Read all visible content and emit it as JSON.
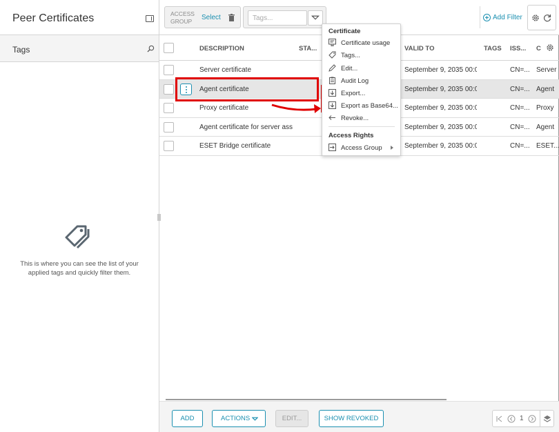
{
  "left_panel": {
    "title": "Peer Certificates",
    "tags_label": "Tags",
    "empty_message": "This is where you can see the list of your applied tags and quickly filter them."
  },
  "filter_bar": {
    "access_group_label": "ACCESS GROUP",
    "select_label": "Select",
    "tags_placeholder": "Tags...",
    "add_filter_label": "Add Filter"
  },
  "table": {
    "columns": [
      "DESCRIPTION",
      "STA...",
      "VALID TO",
      "TAGS",
      "ISS...",
      "C"
    ],
    "rows": [
      {
        "description": "Server certificate",
        "valid_to": "September 9, 2035 00:0...",
        "issuer": "CN=...",
        "c": "Server",
        "selected": false
      },
      {
        "description": "Agent certificate",
        "valid_to": "September 9, 2035 00:0...",
        "issuer": "CN=...",
        "c": "Agent",
        "selected": true
      },
      {
        "description": "Proxy certificate",
        "valid_to": "September 9, 2035 00:0...",
        "issuer": "CN=...",
        "c": "Proxy",
        "selected": false
      },
      {
        "description": "Agent certificate for server assi...",
        "valid_to": "September 9, 2035 00:0...",
        "issuer": "CN=...",
        "c": "Agent",
        "selected": false
      },
      {
        "description": "ESET Bridge certificate",
        "valid_to": "September 9, 2035 00:0...",
        "issuer": "CN=...",
        "c": "ESET...",
        "selected": false
      }
    ]
  },
  "context_menu": {
    "section_certificate": "Certificate",
    "items": [
      {
        "label": "Certificate usage",
        "icon": "certificate-usage-icon"
      },
      {
        "label": "Tags...",
        "icon": "tag-icon"
      },
      {
        "label": "Edit...",
        "icon": "pencil-icon"
      },
      {
        "label": "Audit Log",
        "icon": "clipboard-icon"
      },
      {
        "label": "Export...",
        "icon": "download-icon"
      },
      {
        "label": "Export as Base64...",
        "icon": "download-icon"
      },
      {
        "label": "Revoke...",
        "icon": "arrow-left-icon"
      }
    ],
    "section_access": "Access Rights",
    "access_group_item": "Access Group"
  },
  "bottom_bar": {
    "add": "ADD",
    "actions": "ACTIONS",
    "edit": "EDIT...",
    "show_revoked": "SHOW REVOKED",
    "page": "1"
  },
  "colors": {
    "accent": "#1a8fb0",
    "highlight": "#e00000",
    "selected_row": "#e6e6e6"
  }
}
